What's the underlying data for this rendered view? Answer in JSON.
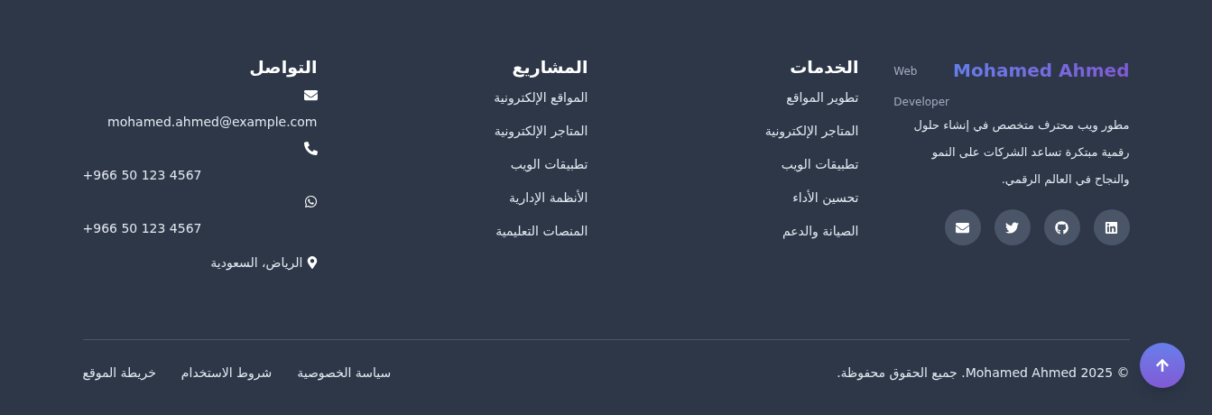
{
  "brand": {
    "name": "Mohamed Ahmed",
    "tagline": "Web Developer",
    "description": "مطور ويب محترف متخصص في إنشاء حلول رقمية مبتكرة تساعد الشركات على النمو والنجاح في العالم الرقمي.",
    "socials": [
      {
        "kind": "linkedin"
      },
      {
        "kind": "github"
      },
      {
        "kind": "twitter"
      },
      {
        "kind": "email"
      }
    ]
  },
  "columns": [
    {
      "title": "الخدمات",
      "links": [
        "تطوير المواقع",
        "المتاجر الإلكترونية",
        "تطبيقات الويب",
        "تحسين الأداء",
        "الصيانة والدعم"
      ]
    },
    {
      "title": "المشاريع",
      "links": [
        "المواقع الإلكترونية",
        "المتاجر الإلكترونية",
        "تطبيقات الويب",
        "الأنظمة الإدارية",
        "المنصات التعليمية"
      ]
    }
  ],
  "contact": {
    "title": "التواصل",
    "items": [
      {
        "kind": "email",
        "text": "mohamed.ahmed@example.com"
      },
      {
        "kind": "phone",
        "text": "+966 50 123 4567"
      },
      {
        "kind": "whatsapp",
        "text": "+966 50 123 4567"
      },
      {
        "kind": "location",
        "text": "الرياض، السعودية"
      }
    ]
  },
  "copyright": "© 2025 Mohamed Ahmed. جميع الحقوق محفوظة.",
  "bottom_links": [
    "سياسة الخصوصية",
    "شروط الاستخدام",
    "خريطة الموقع"
  ]
}
